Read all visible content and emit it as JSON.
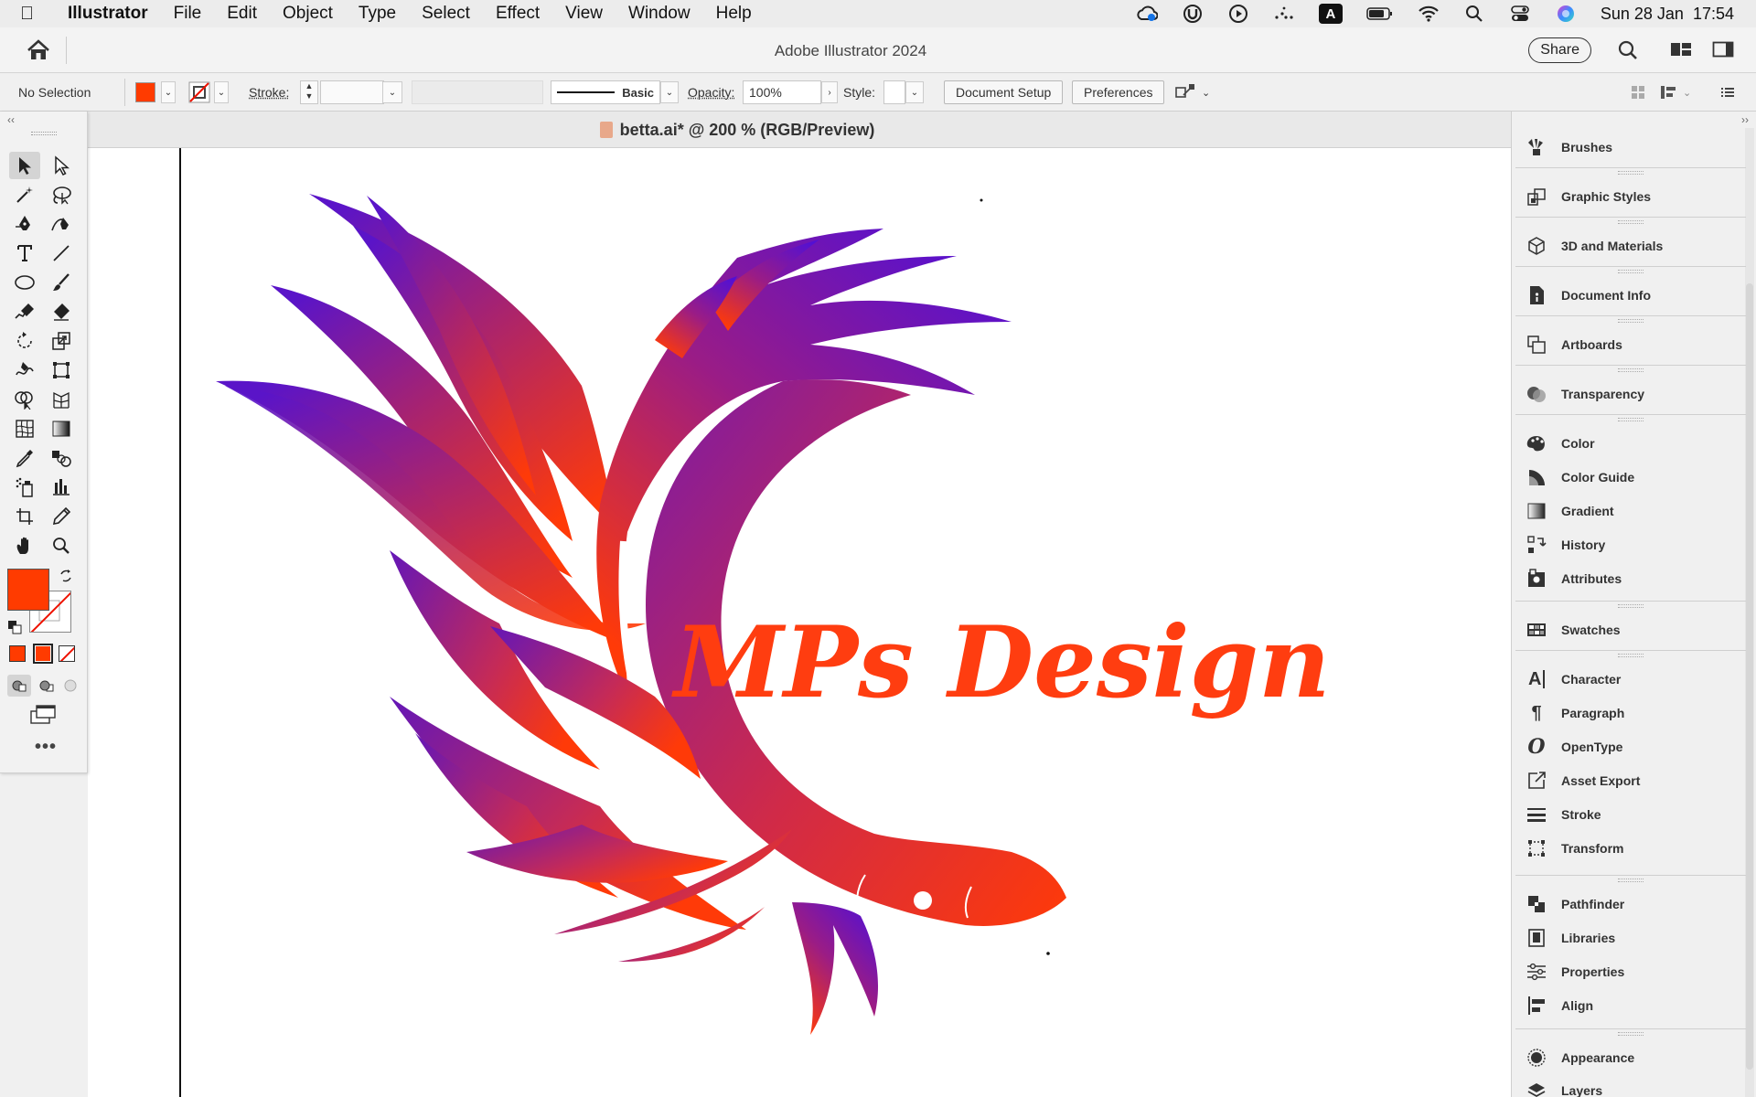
{
  "menubar": {
    "app": "Illustrator",
    "items": [
      "File",
      "Edit",
      "Object",
      "Type",
      "Select",
      "Effect",
      "View",
      "Window",
      "Help"
    ],
    "input_source": "A",
    "clock": "Sun 28 Jan  17:54"
  },
  "titlebar": {
    "title": "Adobe Illustrator 2024",
    "share_label": "Share"
  },
  "controlbar": {
    "selection_status": "No Selection",
    "stroke_label": "Stroke:",
    "brush_profile": "Basic",
    "opacity_label": "Opacity:",
    "opacity_value": "100%",
    "style_label": "Style:",
    "document_setup_label": "Document Setup",
    "preferences_label": "Preferences"
  },
  "document": {
    "tab_title": "betta.ai* @ 200 % (RGB/Preview)"
  },
  "artwork": {
    "logo_text": "MPs Design"
  },
  "panels": {
    "groups": [
      [
        "Brushes"
      ],
      [
        "Graphic Styles"
      ],
      [
        "3D and Materials"
      ],
      [
        "Document Info"
      ],
      [
        "Artboards"
      ],
      [
        "Transparency"
      ],
      [
        "Color",
        "Color Guide",
        "Gradient",
        "History",
        "Attributes"
      ],
      [
        "Swatches"
      ],
      [
        "Character",
        "Paragraph",
        "OpenType",
        "Asset Export",
        "Stroke",
        "Transform"
      ],
      [
        "Pathfinder",
        "Libraries",
        "Properties",
        "Align"
      ],
      [
        "Appearance",
        "Layers"
      ]
    ]
  },
  "colors": {
    "fill": "#ff3b00",
    "logo_text": "#ff3d10",
    "gradient_start": "#5a14c8",
    "gradient_mid": "#b02a6a",
    "gradient_end": "#ff3a08"
  }
}
